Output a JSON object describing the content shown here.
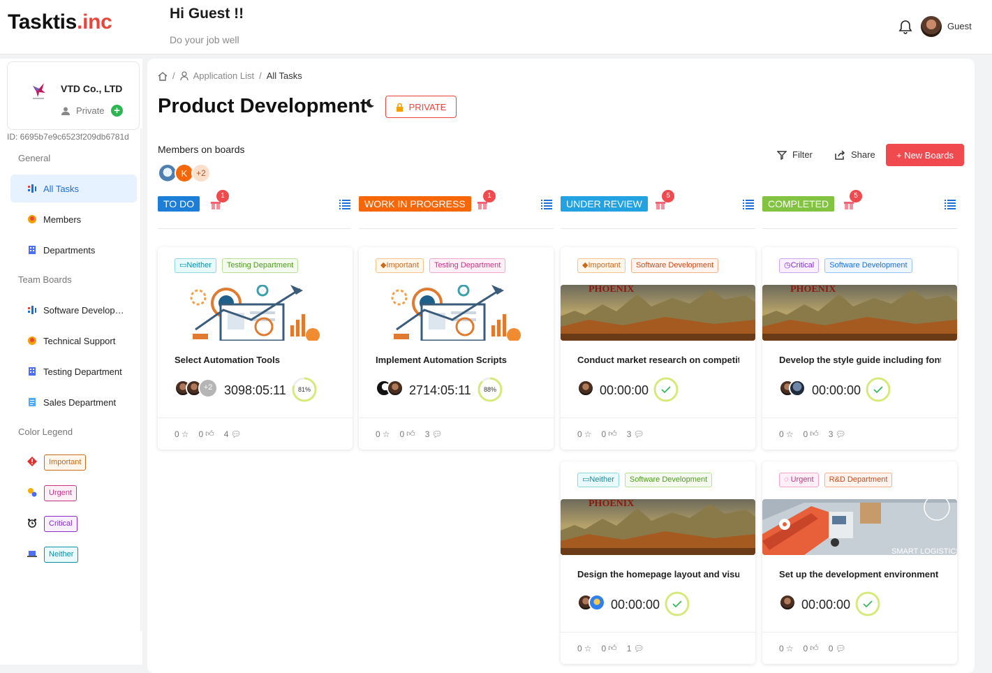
{
  "header": {
    "logo_main": "Tasktis",
    "logo_suffix": ".inc",
    "greeting": "Hi Guest !!",
    "subtitle": "Do your job well",
    "user": "Guest"
  },
  "sidebar": {
    "org_name": "VTD Co., LTD",
    "org_privacy": "Private",
    "org_id": "ID: 6695b7e9c6523f209db6781d",
    "section_general": "General",
    "general_items": [
      {
        "label": "All Tasks"
      },
      {
        "label": "Members"
      },
      {
        "label": "Departments"
      }
    ],
    "section_team": "Team Boards",
    "team_items": [
      {
        "label": "Software Development"
      },
      {
        "label": "Technical Support"
      },
      {
        "label": "Testing Department"
      },
      {
        "label": "Sales Department"
      }
    ],
    "section_legend": "Color Legend",
    "legend": [
      "Important",
      "Urgent",
      "Critical",
      "Neither"
    ]
  },
  "main": {
    "breadcrumb": [
      "Application List",
      "All Tasks"
    ],
    "title": "Product Development",
    "privacy": "PRIVATE",
    "members_label": "Members on boards",
    "members": [
      "",
      "K",
      "+2"
    ],
    "filter": "Filter",
    "share": "Share",
    "new_boards": "+ New Boards"
  },
  "columns": [
    {
      "name": "TO DO",
      "badge": "1",
      "color": "#1c7ed6"
    },
    {
      "name": "WORK IN PROGRESS",
      "badge": "1",
      "color": "#f76707"
    },
    {
      "name": "UNDER REVIEW",
      "badge": "5",
      "color": "#22a2e0"
    },
    {
      "name": "COMPLETED",
      "badge": "5",
      "color": "#82c341"
    }
  ],
  "cards": [
    {
      "tags": [
        "Neither",
        "Testing Department"
      ],
      "title": "Select Automation Tools",
      "time": "3098:05:11",
      "progress": "81%",
      "extra": "+2",
      "stars": "0",
      "likes": "0",
      "comments": "4"
    },
    {
      "tags": [
        "Important",
        "Testing Department"
      ],
      "title": "Implement Automation Scripts",
      "time": "2714:05:11",
      "progress": "88%",
      "stars": "0",
      "likes": "0",
      "comments": "3"
    },
    {
      "tags": [
        "Important",
        "Software Development"
      ],
      "title": "Conduct market research on competitors",
      "time": "00:00:00",
      "stars": "0",
      "likes": "0",
      "comments": "3"
    },
    {
      "tags": [
        "Critical",
        "Software Development"
      ],
      "title": "Develop the style guide including fonts",
      "time": "00:00:00",
      "stars": "0",
      "likes": "0",
      "comments": "3"
    },
    {
      "tags": [
        "Neither",
        "Software Development"
      ],
      "title": "Design the homepage layout and visuals",
      "time": "00:00:00",
      "stars": "0",
      "likes": "0",
      "comments": "1"
    },
    {
      "tags": [
        "Urgent",
        "R&D Department"
      ],
      "title": "Set up the development environment and tools",
      "time": "00:00:00",
      "stars": "0",
      "likes": "0",
      "comments": "0"
    }
  ],
  "image_text": {
    "phoenix": "PHOENIX",
    "logistics": "SMART LOGISTICS"
  }
}
